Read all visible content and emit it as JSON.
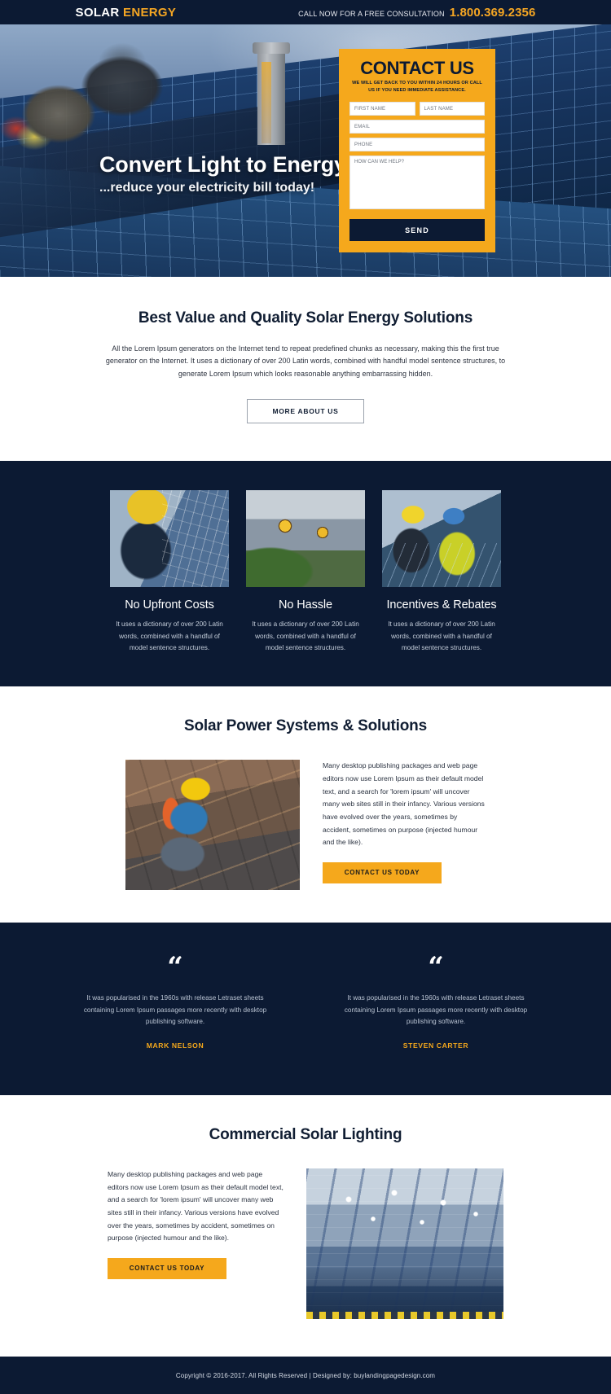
{
  "topbar": {
    "logo_word1": "SOLAR",
    "logo_word2": "ENERGY",
    "call_label": "CALL NOW FOR A FREE CONSULTATION",
    "phone": "1.800.369.2356"
  },
  "hero": {
    "title": "Convert Light to Energy",
    "subtitle": "...reduce your electricity bill today!",
    "form": {
      "title": "CONTACT US",
      "subtitle": "WE WILL GET BACK TO YOU WITHIN 24 HOURS OR CALL US IF YOU NEED IMMEDIATE ASSISTANCE.",
      "first_name_placeholder": "FIRST NAME",
      "last_name_placeholder": "LAST NAME",
      "email_placeholder": "EMAIL",
      "phone_placeholder": "PHONE",
      "message_placeholder": "HOW CAN WE HELP?",
      "send_label": "SEND"
    }
  },
  "intro": {
    "heading": "Best Value and Quality Solar Energy Solutions",
    "paragraph": "All the Lorem Ipsum generators on the Internet tend to repeat predefined chunks as necessary, making this the first true generator on the Internet. It uses a dictionary of over 200 Latin words, combined with handful model sentence structures, to generate Lorem Ipsum which looks reasonable anything embarrassing hidden.",
    "button_label": "MORE ABOUT US"
  },
  "features": [
    {
      "image_name": "installer-with-panel-photo",
      "title": "No Upfront Costs",
      "body": "It uses a dictionary of over 200 Latin words, combined with a handful of model sentence structures."
    },
    {
      "image_name": "sunflowers-rooftop-panels-photo",
      "title": "No Hassle",
      "body": "It uses a dictionary of over 200 Latin words, combined with a handful of model sentence structures."
    },
    {
      "image_name": "engineers-inspecting-panels-photo",
      "title": "Incentives & Rebates",
      "body": "It uses a dictionary of over 200 Latin words, combined with a handful of model sentence structures."
    }
  ],
  "solar_power": {
    "heading": "Solar Power Systems & Solutions",
    "image_name": "worker-kneeling-on-solar-array-photo",
    "paragraph": "Many desktop publishing packages and web page editors now use Lorem Ipsum as their default model text, and a search for 'lorem ipsum' will uncover many web sites still in their infancy. Various versions have evolved over the years, sometimes by accident, sometimes on purpose (injected humour and the like).",
    "button_label": "CONTACT US TODAY"
  },
  "testimonials": [
    {
      "quote_mark": "“",
      "body": "It was popularised in the 1960s with release Letraset sheets containing Lorem Ipsum passages more recently with desktop publishing software.",
      "name": "MARK NELSON"
    },
    {
      "quote_mark": "“",
      "body": "It was popularised in the 1960s with release Letraset sheets containing Lorem Ipsum passages more recently with desktop publishing software.",
      "name": "STEVEN CARTER"
    }
  ],
  "commercial": {
    "heading": "Commercial Solar Lighting",
    "paragraph": "Many desktop publishing packages and web page editors now use Lorem Ipsum as their default model text, and a search for 'lorem ipsum' will uncover many web sites still in their infancy. Various versions have evolved over the years, sometimes by accident, sometimes on purpose (injected humour and the like).",
    "button_label": "CONTACT US TODAY",
    "image_name": "industrial-warehouse-lighting-photo"
  },
  "footer": {
    "text": "Copyright © 2016-2017. All Rights Reserved  |  Designed by: buylandingpagedesign.com"
  },
  "colors": {
    "navy": "#0c1a33",
    "amber": "#f5a81c",
    "white": "#ffffff"
  }
}
